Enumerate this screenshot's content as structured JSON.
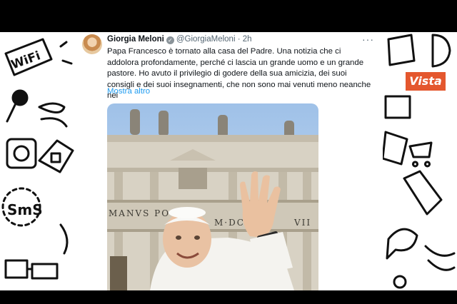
{
  "tweet": {
    "author_name": "Giorgia Meloni",
    "handle": "@GiorgiaMeloni",
    "separator": "·",
    "time": "2h",
    "text": "Papa Francesco è tornato alla casa del Padre. Una notizia che ci addolora profondamente, perché ci lascia un grande uomo e un grande pastore. Ho avuto il privilegio di godere della sua amicizia, dei suoi consigli e dei suoi insegnamenti, che non sono mai venuti meno neanche nei",
    "show_more": "Mostra altro",
    "verified_icon": "verified-badge-icon",
    "more_icon": "more-options-icon"
  },
  "photo": {
    "inscription": "MANVS PO",
    "inscription_right": "M·DCA",
    "inscription_far": "VII"
  },
  "watermark": {
    "text": "Vista"
  },
  "doodles": {
    "wifi": "WiFi",
    "sms": "SmS"
  },
  "colors": {
    "link": "#1d9bf0",
    "watermark_bg": "#e4572e"
  }
}
